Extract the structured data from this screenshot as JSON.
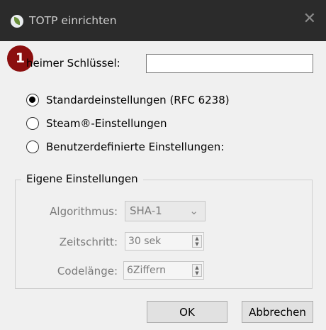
{
  "window": {
    "title": "TOTP einrichten",
    "close_glyph": "✕",
    "app_icon": "keepass-icon"
  },
  "annotation": {
    "badge_number": "1"
  },
  "secret": {
    "label": "heimer Schlüssel:",
    "value": ""
  },
  "modes": [
    {
      "label": "Standardeinstellungen (RFC 6238)",
      "checked": true
    },
    {
      "label": "Steam®-Einstellungen",
      "checked": false
    },
    {
      "label": "Benutzerdefinierte Einstellungen:",
      "checked": false
    }
  ],
  "custom": {
    "title": "Eigene Einstellungen",
    "algorithm_label": "Algorithmus:",
    "algorithm_value": "SHA-1",
    "timestep_label": "Zeitschritt:",
    "timestep_value": "30 sek",
    "codelength_label": "Codelänge:",
    "codelength_value": "6Ziffern"
  },
  "buttons": {
    "ok": "OK",
    "cancel": "Abbrechen"
  }
}
